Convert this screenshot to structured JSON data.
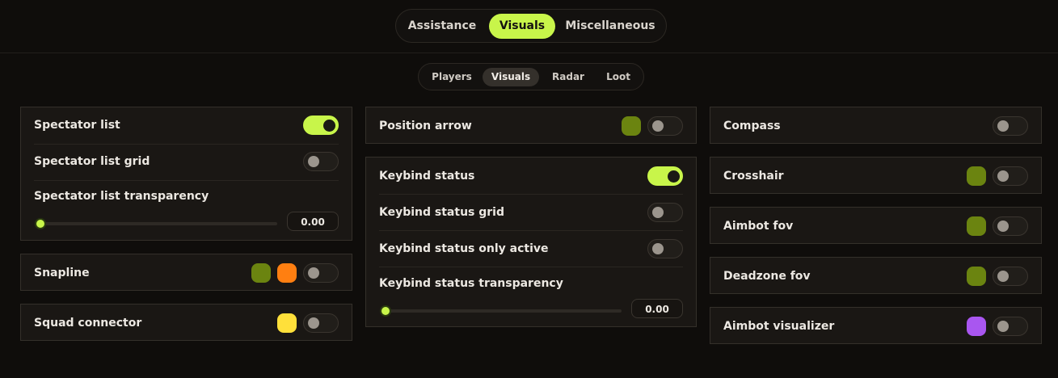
{
  "top_tabs": [
    {
      "label": "Assistance"
    },
    {
      "label": "Visuals",
      "active": true
    },
    {
      "label": "Miscellaneous"
    }
  ],
  "sub_tabs": [
    {
      "label": "Players"
    },
    {
      "label": "Visuals",
      "active": true
    },
    {
      "label": "Radar"
    },
    {
      "label": "Loot"
    }
  ],
  "colors": {
    "accent": "#c8f54a",
    "olive": "#6b8410",
    "orange": "#ff7f11",
    "yellow": "#ffe03a",
    "purple": "#a956f0"
  },
  "left": {
    "spectator": {
      "list": {
        "label": "Spectator list",
        "on": true
      },
      "grid": {
        "label": "Spectator list grid",
        "on": false
      },
      "transparency": {
        "label": "Spectator list transparency",
        "value": "0.00"
      }
    },
    "snapline": {
      "label": "Snapline",
      "on": false
    },
    "squad": {
      "label": "Squad connector",
      "on": false
    }
  },
  "middle": {
    "position_arrow": {
      "label": "Position arrow",
      "on": false
    },
    "keybind": {
      "status": {
        "label": "Keybind status",
        "on": true
      },
      "grid": {
        "label": "Keybind status grid",
        "on": false
      },
      "only_active": {
        "label": "Keybind status only active",
        "on": false
      },
      "transparency": {
        "label": "Keybind status transparency",
        "value": "0.00"
      }
    }
  },
  "right": {
    "compass": {
      "label": "Compass",
      "on": false
    },
    "crosshair": {
      "label": "Crosshair",
      "on": false
    },
    "aimbot_fov": {
      "label": "Aimbot fov",
      "on": false
    },
    "deadzone_fov": {
      "label": "Deadzone fov",
      "on": false
    },
    "aimbot_visualizer": {
      "label": "Aimbot visualizer",
      "on": false
    }
  }
}
